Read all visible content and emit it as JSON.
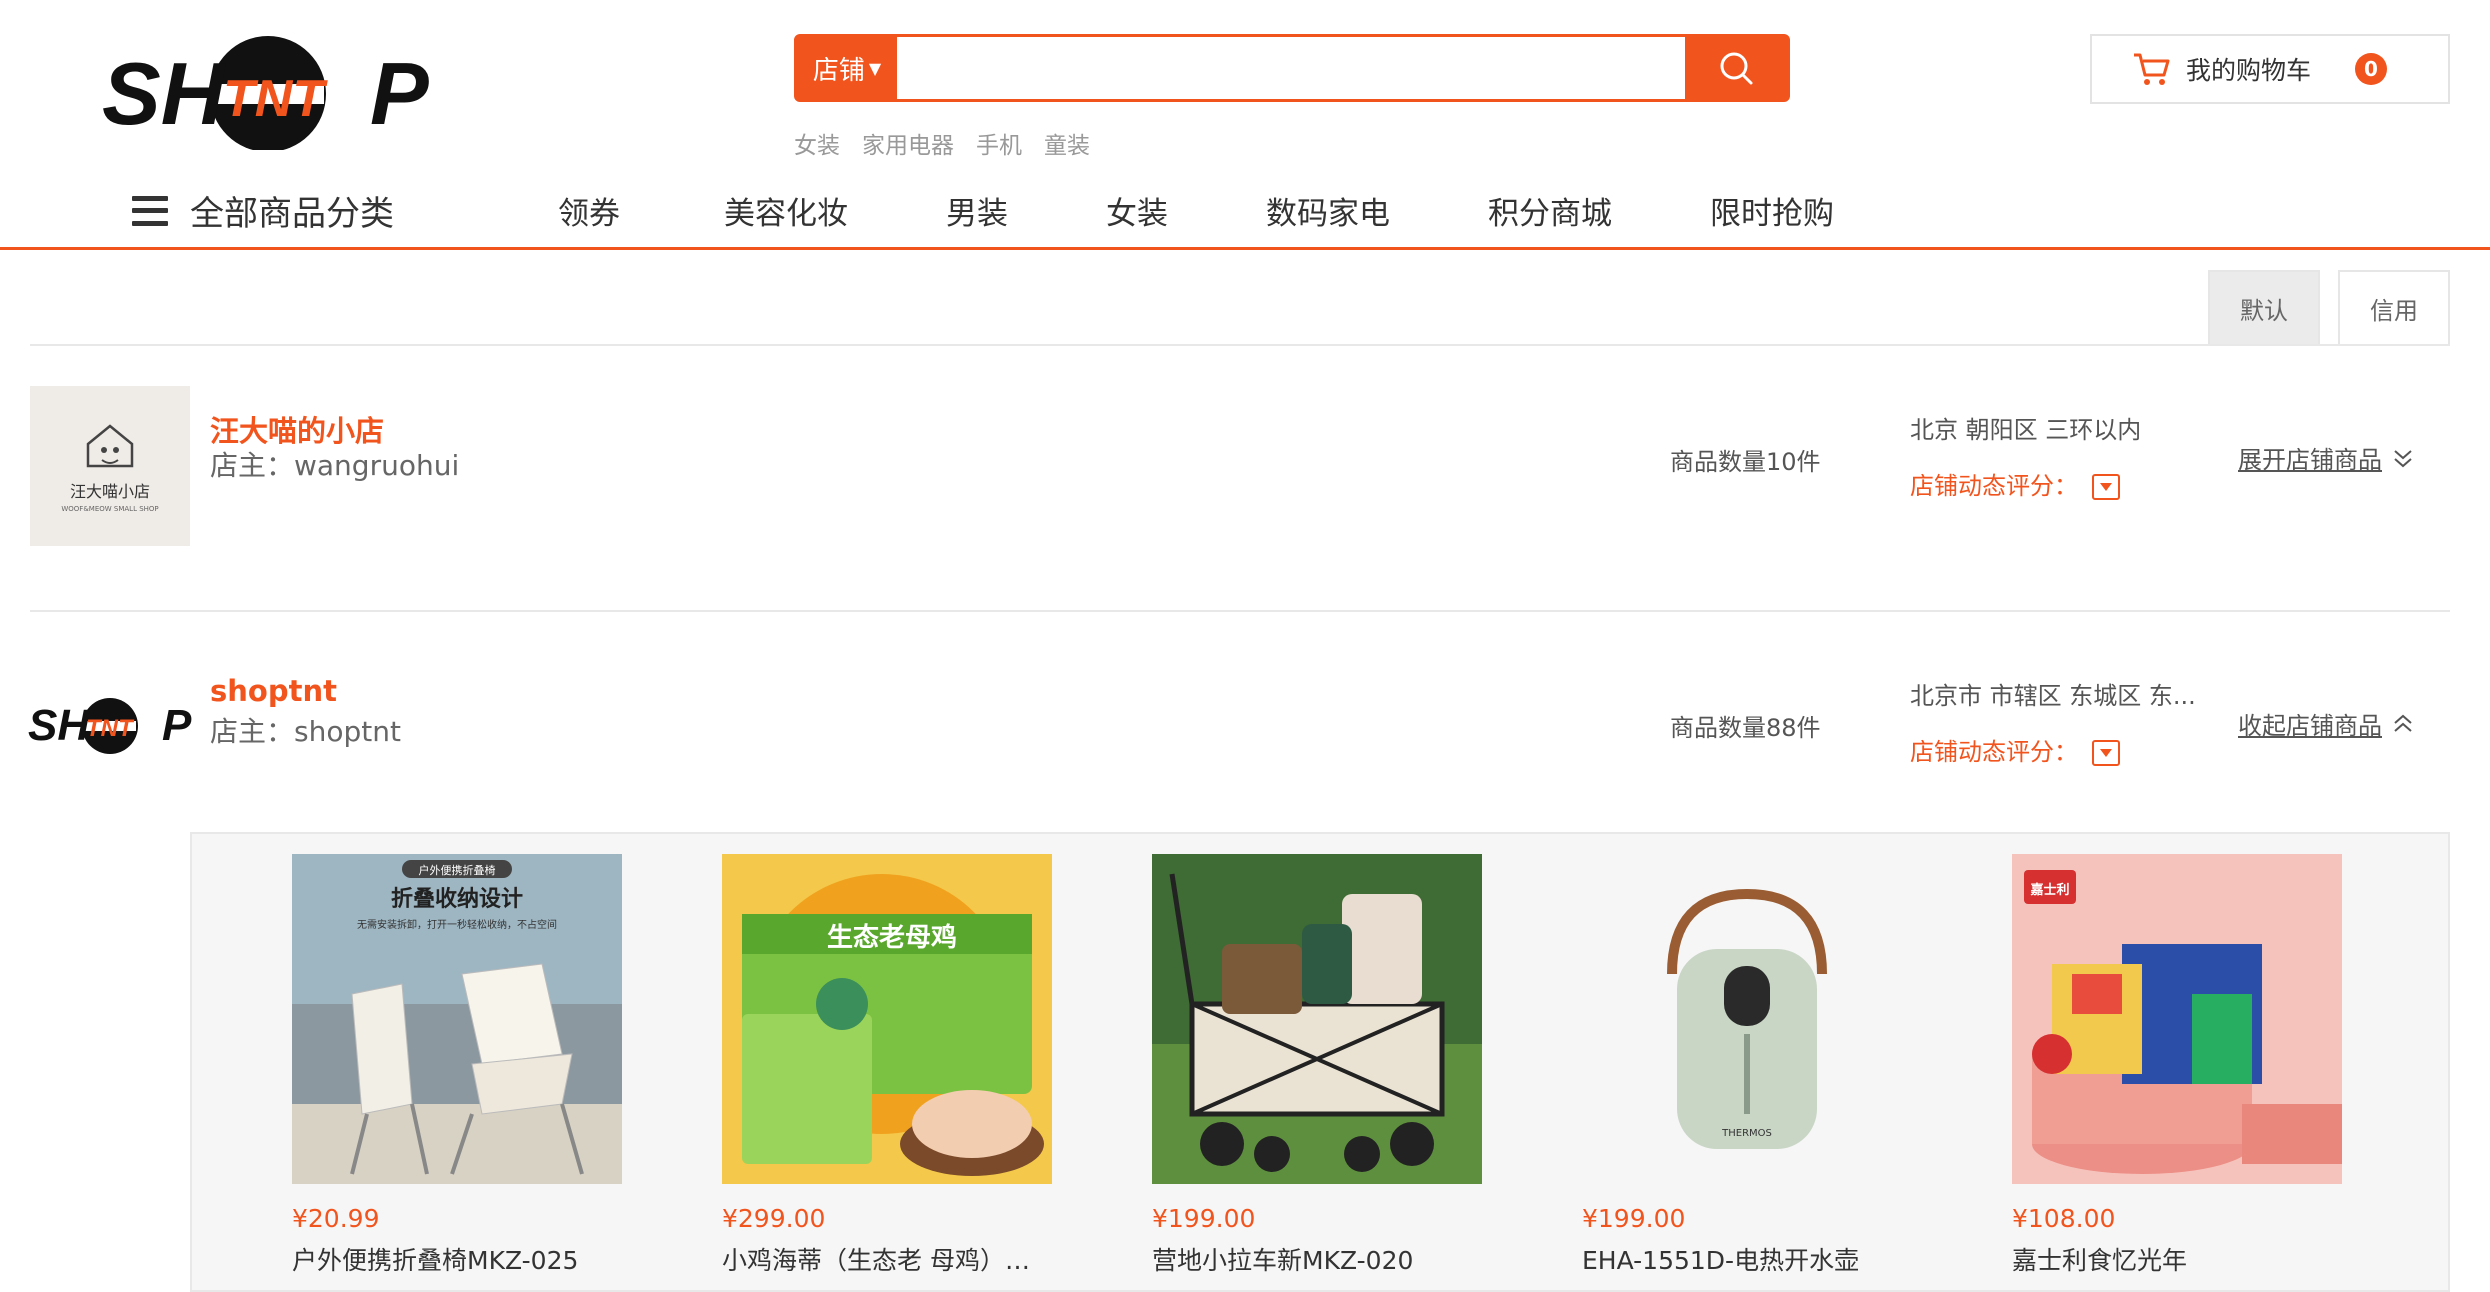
{
  "logo": {
    "left": "SH",
    "mid": "TNT",
    "right": "P"
  },
  "search": {
    "type_label": "店铺",
    "placeholder": "",
    "hot": [
      "女装",
      "家用电器",
      "手机",
      "童装"
    ]
  },
  "cart": {
    "label": "我的购物车",
    "count": "0"
  },
  "nav": {
    "all_label": "全部商品分类",
    "links": [
      "领券",
      "美容化妆",
      "男装",
      "女装",
      "数码家电",
      "积分商城",
      "限时抢购"
    ]
  },
  "sort": {
    "default": "默认",
    "credit": "信用"
  },
  "shops": [
    {
      "name": "汪大喵的小店",
      "owner": "店主：wangruohui",
      "logo_text": "汪大喵小店",
      "logo_sub": "WOOF&MEOW SMALL SHOP",
      "count": "商品数量10件",
      "location": "北京 朝阳区 三环以内",
      "rating_label": "店铺动态评分：",
      "toggle": "展开店铺商品"
    },
    {
      "name": "shoptnt",
      "owner": "店主：shoptnt",
      "count": "商品数量88件",
      "location": "北京市 市辖区 东城区 东...",
      "rating_label": "店铺动态评分：",
      "toggle": "收起店铺商品"
    }
  ],
  "products": [
    {
      "price": "¥20.99",
      "name": "户外便携折叠椅MKZ-025",
      "img_title": "折叠收纳设计",
      "img_tag": "户外便携折叠椅",
      "img_sub": "无需安装拆卸，打开一秒轻松收纳，不占空间"
    },
    {
      "price": "¥299.00",
      "name": "小鸡海蒂（生态老 母鸡）礼...",
      "img_title": "生态老母鸡"
    },
    {
      "price": "¥199.00",
      "name": "营地小拉车新MKZ-020"
    },
    {
      "price": "¥199.00",
      "name": "EHA-1551D-电热开水壶",
      "img_brand": "THERMOS"
    },
    {
      "price": "¥108.00",
      "name": "嘉士利食忆光年",
      "img_brand": "嘉士利"
    }
  ],
  "colors": {
    "accent": "#f2541d"
  }
}
